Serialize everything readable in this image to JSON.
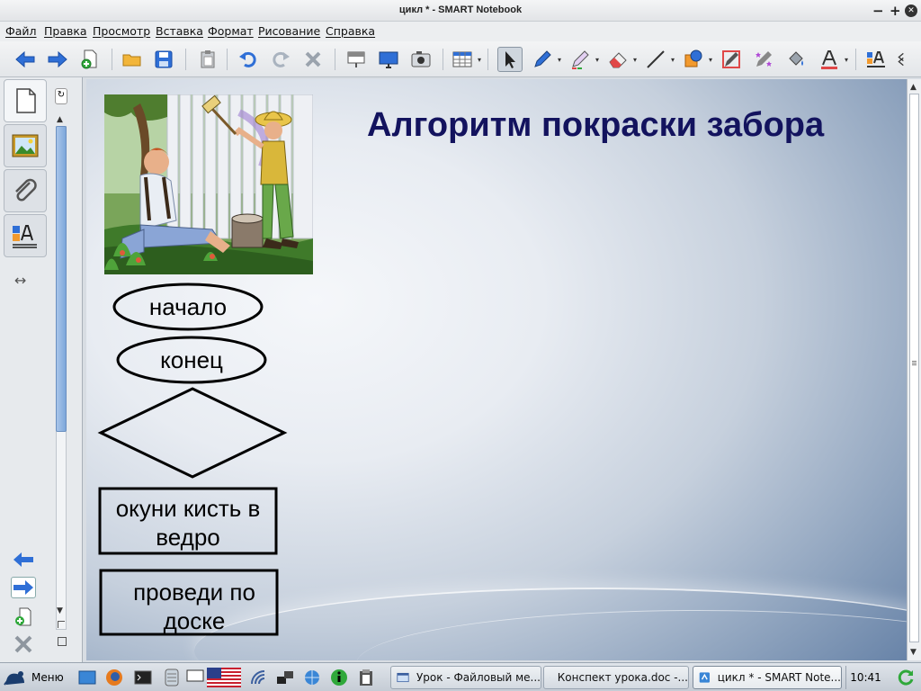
{
  "window": {
    "title": "цикл * - SMART Notebook",
    "controls": {
      "minimize": "−",
      "maximize": "+",
      "close": "✕"
    }
  },
  "menu": {
    "items": [
      "Файл",
      "Правка",
      "Просмотр",
      "Вставка",
      "Формат",
      "Рисование",
      "Справка"
    ]
  },
  "toolbar": {
    "icons": [
      "back-arrow-icon",
      "forward-arrow-icon",
      "add-page-icon",
      "open-folder-icon",
      "save-icon",
      "paste-icon",
      "undo-icon",
      "redo-icon",
      "delete-icon",
      "screen-shade-icon",
      "full-screen-icon",
      "capture-icon",
      "table-icon",
      "select-icon",
      "pen-icon",
      "creative-pen-icon",
      "eraser-icon",
      "line-icon",
      "shape-icon",
      "magic-pen-icon",
      "shape-recognition-pen-icon",
      "fill-icon",
      "text-icon",
      "properties-icon"
    ],
    "accent": "#2f6fd6"
  },
  "sidebar": {
    "tabs": [
      "page-sorter-icon",
      "gallery-icon",
      "attachments-icon",
      "properties-icon"
    ],
    "resize_symbol": "↔"
  },
  "slide": {
    "title": "Алгоритм покраски забора",
    "title_color": "#13135e",
    "shapes": {
      "start": "начало",
      "end": "конец",
      "decision": "",
      "process1": "окуни кисть в ведро",
      "process2": "проведи по доске"
    }
  },
  "taskbar": {
    "menu_label": "Меню",
    "tasks": [
      {
        "label": "Урок - Файловый ме...",
        "active": false
      },
      {
        "label": "Конспект урока.doc -...",
        "active": false
      },
      {
        "label": "цикл * - SMART Note...",
        "active": true
      }
    ],
    "clock": "10:41"
  }
}
